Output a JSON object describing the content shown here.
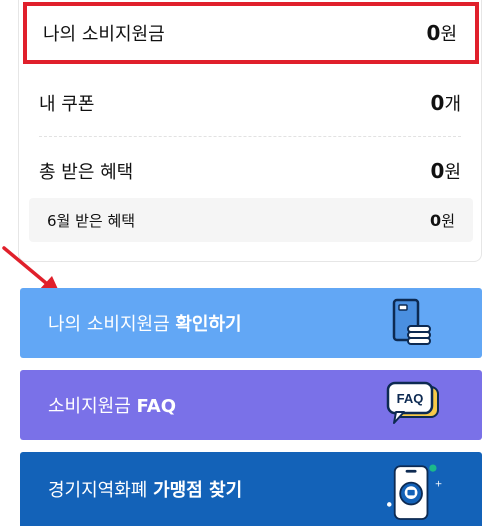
{
  "summary": {
    "benefit": {
      "label": "나의 소비지원금",
      "amount": "0",
      "unit": "원"
    },
    "coupon": {
      "label": "내 쿠폰",
      "amount": "0",
      "unit": "개"
    },
    "total": {
      "label": "총 받은 혜택",
      "amount": "0",
      "unit": "원"
    },
    "month": {
      "label": "6월 받은 혜택",
      "amount": "0",
      "unit": "원"
    }
  },
  "actions": {
    "check": {
      "text": "나의 소비지원금 ",
      "bold": "확인하기",
      "icon": "card-coins-icon"
    },
    "faq": {
      "text": "소비지원금 ",
      "bold": "FAQ",
      "icon": "faq-bubble-icon",
      "icon_label": "FAQ"
    },
    "store": {
      "text": "경기지역화폐 ",
      "bold": "가맹점 찾기",
      "icon": "phone-location-icon"
    }
  },
  "colors": {
    "highlight": "#e0202b",
    "check_bg": "#62a7f5",
    "faq_bg": "#7a71e8",
    "store_bg": "#1362b8"
  }
}
